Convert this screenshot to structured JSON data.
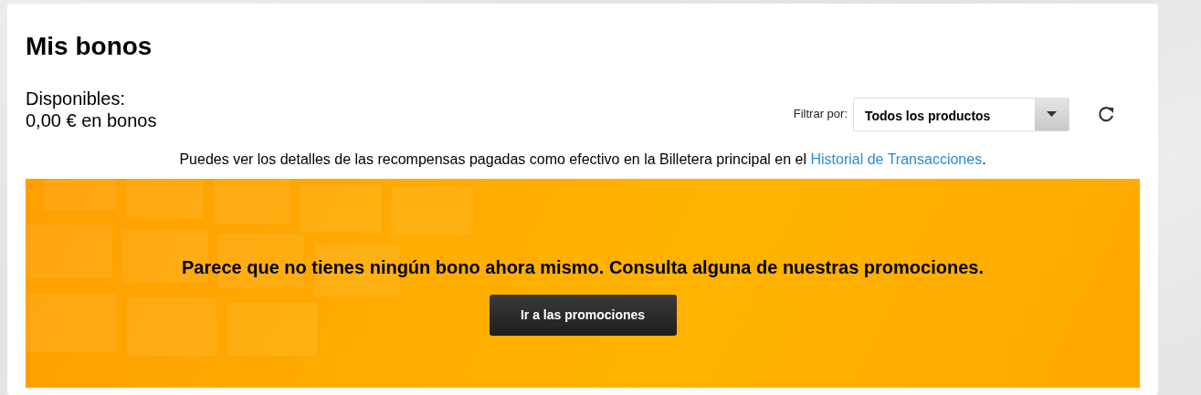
{
  "title": "Mis bonos",
  "balance": {
    "label": "Disponibles:",
    "amount": "0,00 € en bonos"
  },
  "filter": {
    "label": "Filtrar por:",
    "value": "Todos los productos"
  },
  "info": {
    "before": "Puedes ver los detalles de las recompensas pagadas como efectivo en la Billetera principal en el ",
    "link": "Historial de Transacciones",
    "after": "."
  },
  "banner": {
    "message": "Parece que no tienes ningún bono ahora mismo. Consulta alguna de nuestras promociones.",
    "button": "Ir a las promociones"
  }
}
